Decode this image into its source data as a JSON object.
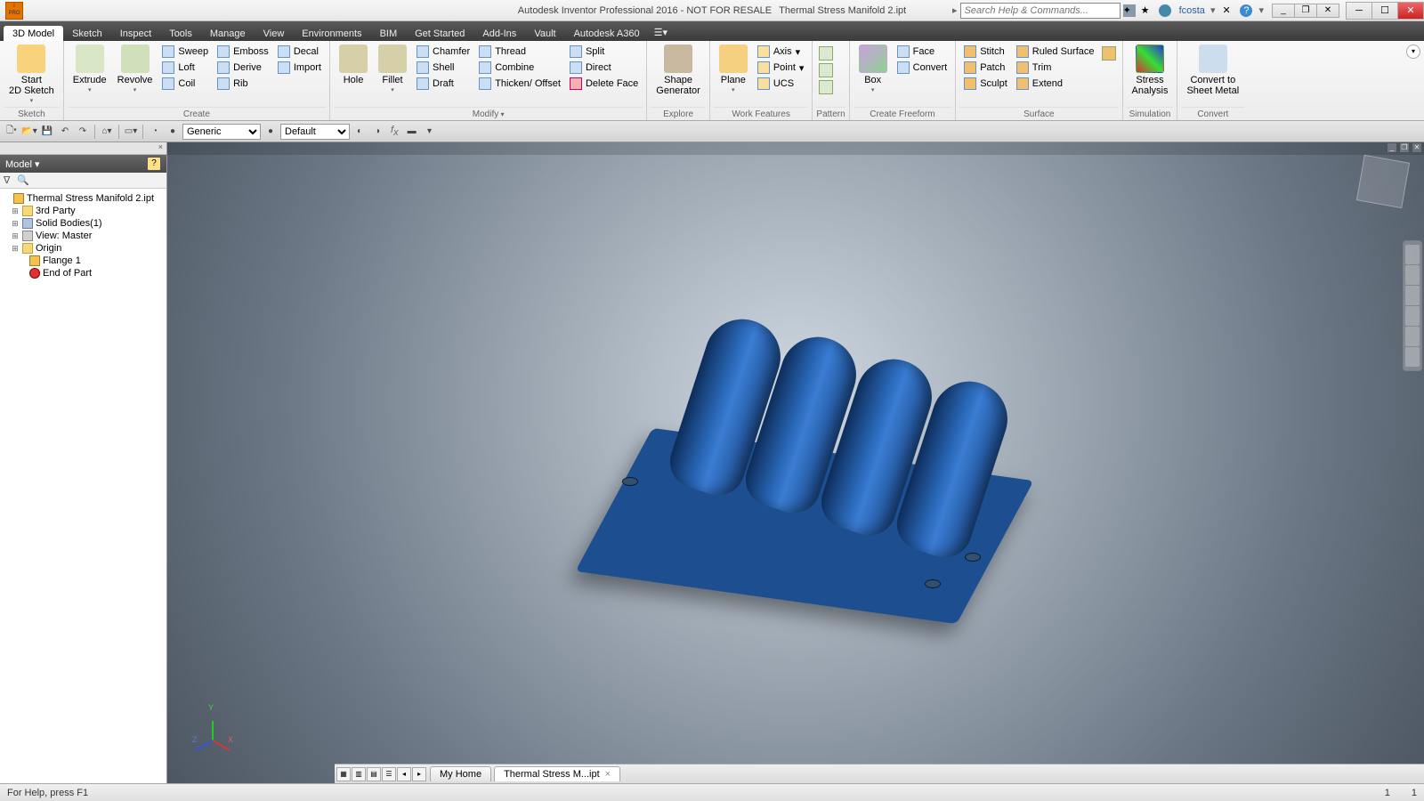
{
  "title": {
    "app": "Autodesk Inventor Professional 2016 - NOT FOR RESALE",
    "file": "Thermal Stress Manifold 2.ipt"
  },
  "search": {
    "placeholder": "Search Help & Commands..."
  },
  "user": "fcosta",
  "ribbonTabs": [
    "3D Model",
    "Sketch",
    "Inspect",
    "Tools",
    "Manage",
    "View",
    "Environments",
    "BIM",
    "Get Started",
    "Add-Ins",
    "Vault",
    "Autodesk A360"
  ],
  "sketch": {
    "big": "Start\n2D Sketch",
    "label": "Sketch"
  },
  "create": {
    "big": [
      "Extrude",
      "Revolve"
    ],
    "cols": [
      [
        "Sweep",
        "Loft",
        "Coil"
      ],
      [
        "Emboss",
        "Derive",
        "Rib"
      ],
      [
        "Decal",
        "Import"
      ]
    ],
    "label": "Create"
  },
  "modify": {
    "big": [
      "Hole",
      "Fillet"
    ],
    "cols": [
      [
        "Chamfer",
        "Shell",
        "Draft"
      ],
      [
        "Thread",
        "Combine",
        "Thicken/ Offset"
      ],
      [
        "Split",
        "Direct",
        "Delete Face"
      ]
    ],
    "label": "Modify"
  },
  "explore": {
    "big": "Shape\nGenerator",
    "label": "Explore"
  },
  "work": {
    "big": "Plane",
    "items": [
      "Axis",
      "Point",
      "UCS"
    ],
    "label": "Work Features"
  },
  "pattern": {
    "label": "Pattern"
  },
  "freeform": {
    "big": "Box",
    "items": [
      "Convert"
    ],
    "label": "Create Freeform"
  },
  "surface": {
    "cols": [
      [
        "Stitch",
        "Patch",
        "Sculpt"
      ],
      [
        "Ruled Surface",
        "Trim",
        "Extend"
      ]
    ],
    "label": "Surface"
  },
  "sim": {
    "big": "Stress\nAnalysis",
    "label": "Simulation"
  },
  "convert": {
    "big": "Convert to\nSheet Metal",
    "label": "Convert"
  },
  "face": "Face",
  "qat": {
    "material": "Generic",
    "appearance": "Default"
  },
  "browser": {
    "title": "Model",
    "root": "Thermal Stress Manifold 2.ipt",
    "nodes": [
      "3rd Party",
      "Solid Bodies(1)",
      "View: Master",
      "Origin",
      "Flange 1",
      "End of Part"
    ]
  },
  "docTabs": {
    "home": "My Home",
    "active": "Thermal Stress M...ipt"
  },
  "status": {
    "help": "For Help, press F1",
    "n1": "1",
    "n2": "1"
  }
}
